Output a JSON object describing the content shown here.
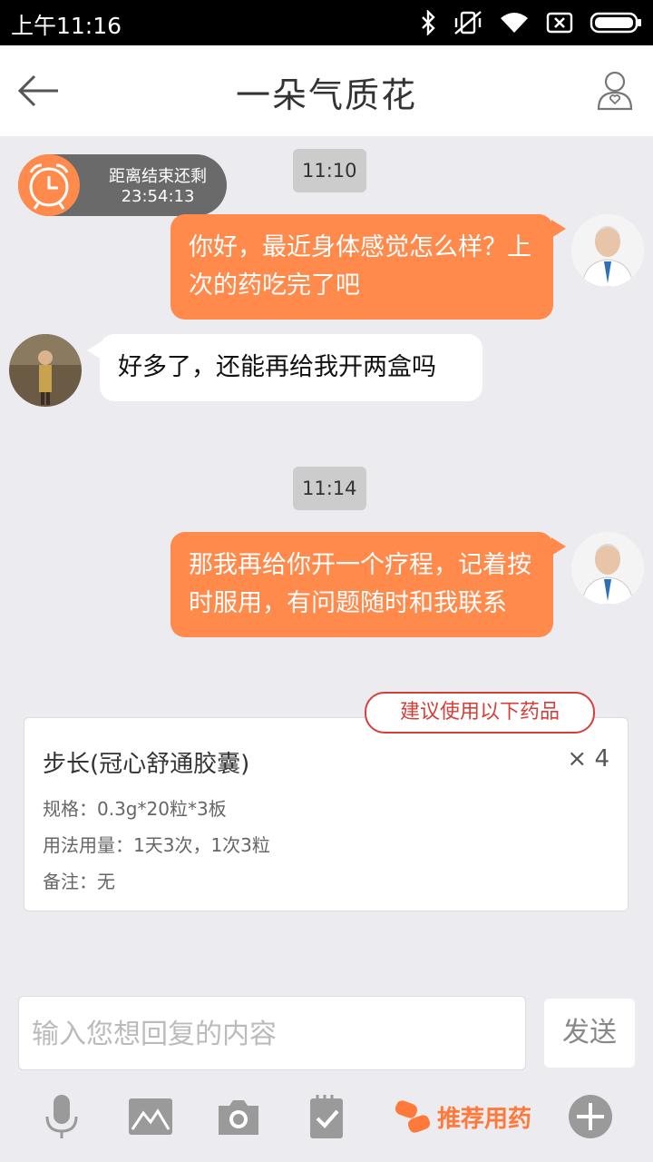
{
  "status_bar": {
    "time": "上午11:16"
  },
  "header": {
    "title": "一朵气质花"
  },
  "countdown": {
    "label": "距离结束还剩",
    "value": "23:54:13"
  },
  "messages": [
    {
      "type": "time",
      "text": "11:10"
    },
    {
      "type": "outgoing",
      "text": "你好，最近身体感觉怎么样？上次的药吃完了吧"
    },
    {
      "type": "incoming",
      "text": "好多了，还能再给我开两盒吗"
    },
    {
      "type": "time",
      "text": "11:14"
    },
    {
      "type": "outgoing",
      "text": "那我再给你开一个疗程，记着按时服用，有问题随时和我联系"
    }
  ],
  "recommendation": {
    "badge": "建议使用以下药品",
    "drug_name": "步长(冠心舒通胶囊)",
    "quantity": "×  4",
    "spec": "规格：0.3g*20粒*3板",
    "dosage": "用法用量：1天3次，1次3粒",
    "note": "备注：无"
  },
  "composer": {
    "placeholder": "输入您想回复的内容",
    "send_label": "发送"
  },
  "toolbar": {
    "recommend_label": "推荐用药"
  },
  "colors": {
    "accent": "#ff8a4b",
    "badge_red": "#d43f3a",
    "icon_gray": "#9a9a9a"
  }
}
